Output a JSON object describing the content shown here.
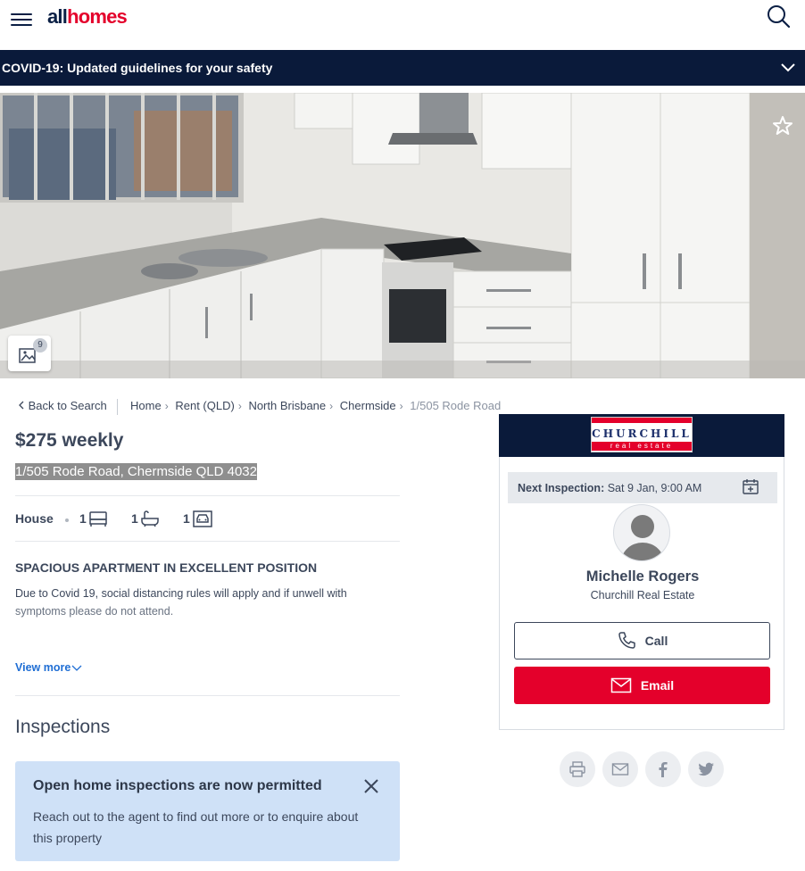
{
  "header": {
    "logo_all": "all",
    "logo_homes": "homes",
    "brand_color": "#e4002b",
    "navy": "#0a1f44"
  },
  "covid_banner": {
    "text": "COVID-19: Updated guidelines for your safety"
  },
  "gallery": {
    "photo_count": "9"
  },
  "breadcrumb": {
    "back": "Back to Search",
    "items": [
      "Home",
      "Rent (QLD)",
      "North Brisbane",
      "Chermside"
    ],
    "current": "1/505 Rode Road"
  },
  "listing": {
    "price": "$275 weekly",
    "address": "1/505 Rode Road, Chermside QLD 4032",
    "property_type": "House",
    "bedrooms": "1",
    "bathrooms": "1",
    "parking": "1",
    "headline": "SPACIOUS APARTMENT IN EXCELLENT POSITION",
    "description_line1": "Due to Covid 19, social distancing rules will apply and if unwell with",
    "description_line2": "symptoms please do not attend.",
    "view_more": "View more"
  },
  "inspections": {
    "title": "Inspections",
    "notice_title": "Open home inspections are now permitted",
    "notice_body": "Reach out to the agent to find out more or to enquire about this property"
  },
  "agent": {
    "agency_logo_name": "CHURCHILL",
    "agency_logo_sub": "real estate",
    "next_inspection_label": "Next Inspection:",
    "next_inspection_value": " Sat 9 Jan, 9:00 AM",
    "name": "Michelle Rogers",
    "agency": "Churchill Real Estate",
    "call_label": "Call",
    "email_label": "Email"
  },
  "share": {
    "icons": [
      "print-icon",
      "mail-icon",
      "facebook-icon",
      "twitter-icon"
    ]
  }
}
